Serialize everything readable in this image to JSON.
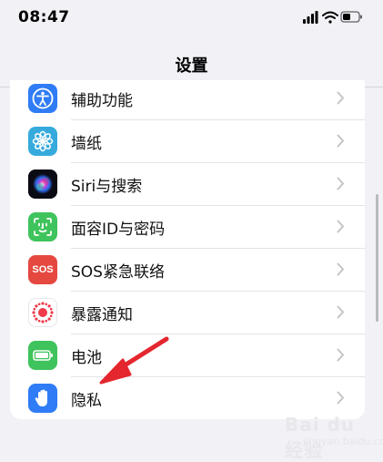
{
  "status_bar": {
    "time": "08:47",
    "icons": [
      "signal-icon",
      "wifi-icon",
      "battery-icon"
    ]
  },
  "header": {
    "title": "设置"
  },
  "settings": {
    "items": [
      {
        "label": "辅助功能",
        "icon": "accessibility-icon",
        "color": "#2f7cf6"
      },
      {
        "label": "墙纸",
        "icon": "wallpaper-flower-icon",
        "color": "#36aadc"
      },
      {
        "label": "Siri与搜索",
        "icon": "siri-icon",
        "color": "#1a1a2e"
      },
      {
        "label": "面容ID与密码",
        "icon": "face-id-icon",
        "color": "#3fc35c"
      },
      {
        "label": "SOS紧急联络",
        "icon": "sos-icon",
        "color": "#e5483f"
      },
      {
        "label": "暴露通知",
        "icon": "exposure-notification-icon",
        "color": "#ffffff"
      },
      {
        "label": "电池",
        "icon": "battery-app-icon",
        "color": "#3fc35c"
      },
      {
        "label": "隐私",
        "icon": "privacy-hand-icon",
        "color": "#2f7cf6"
      }
    ],
    "sos_icon_text": "SOS"
  },
  "watermark": {
    "text": "Bai du 经验",
    "sub": "jingyan.baidu.com"
  },
  "colors": {
    "background": "#f1f1f6",
    "chevron": "#c4c4c8",
    "arrow": "#e4262e"
  }
}
